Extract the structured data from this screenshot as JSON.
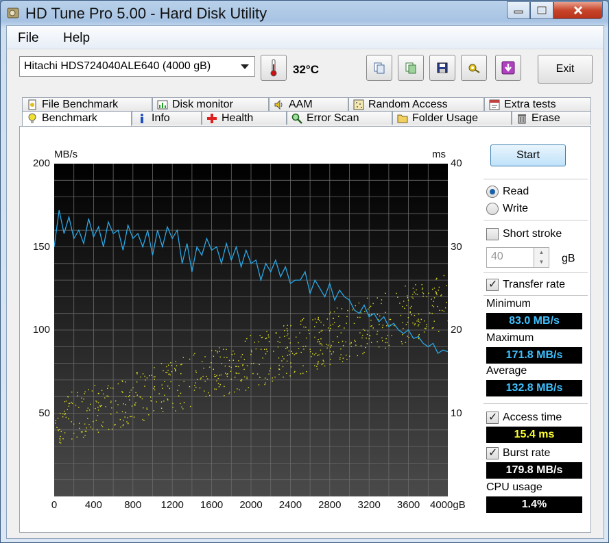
{
  "window": {
    "title": "HD Tune Pro 5.00 - Hard Disk Utility"
  },
  "menu": {
    "file": "File",
    "help": "Help"
  },
  "toolbar": {
    "drive": "Hitachi HDS724040ALE640  (4000 gB)",
    "temperature": "32°C",
    "exit_label": "Exit",
    "icons": [
      "copy-info-icon",
      "copy-screenshot-icon",
      "save-icon",
      "options-icon",
      "download-icon"
    ]
  },
  "tabs_top": [
    "File Benchmark",
    "Disk monitor",
    "AAM",
    "Random Access",
    "Extra tests"
  ],
  "tabs_bottom": [
    "Benchmark",
    "Info",
    "Health",
    "Error Scan",
    "Folder Usage",
    "Erase"
  ],
  "controls": {
    "start_label": "Start",
    "read_label": "Read",
    "write_label": "Write",
    "mode": "read",
    "short_stroke_label": "Short stroke",
    "short_stroke_checked": false,
    "short_stroke_value": "40",
    "short_stroke_unit": "gB",
    "transfer_rate_label": "Transfer rate",
    "transfer_rate_checked": true,
    "access_time_label": "Access time",
    "access_time_checked": true,
    "burst_rate_label": "Burst rate",
    "burst_rate_checked": true,
    "cpu_label": "CPU usage"
  },
  "stats": {
    "minimum_label": "Minimum",
    "minimum": "83.0 MB/s",
    "maximum_label": "Maximum",
    "maximum": "171.8 MB/s",
    "average_label": "Average",
    "average": "132.8 MB/s",
    "access_time": "15.4 ms",
    "burst_rate": "179.8 MB/s",
    "cpu_usage": "1.4%"
  },
  "chart_data": {
    "type": "line",
    "y_left_label": "MB/s",
    "y_right_label": "ms",
    "y_left_ticks": [
      "50",
      "100",
      "150",
      "200"
    ],
    "y_right_ticks": [
      "10",
      "20",
      "30",
      "40"
    ],
    "x_ticks": [
      "0",
      "400",
      "800",
      "1200",
      "1600",
      "2000",
      "2400",
      "2800",
      "3200",
      "3600",
      "4000gB"
    ],
    "xlim": [
      0,
      4000
    ],
    "ylim_left": [
      0,
      200
    ],
    "ylim_right": [
      0,
      40
    ],
    "grid": true,
    "colors": {
      "transfer": "#2aa8e6",
      "access": "#e6e620",
      "bg_top": "#000000",
      "bg_bottom": "#4a4a4a",
      "grid": "#6a6a6a"
    },
    "transfer_series": {
      "name": "Transfer rate",
      "x": [
        0,
        50,
        100,
        150,
        200,
        250,
        300,
        350,
        400,
        450,
        500,
        550,
        600,
        650,
        700,
        750,
        800,
        850,
        900,
        950,
        1000,
        1050,
        1100,
        1150,
        1200,
        1250,
        1300,
        1350,
        1400,
        1450,
        1500,
        1550,
        1600,
        1650,
        1700,
        1750,
        1800,
        1850,
        1900,
        1950,
        2000,
        2050,
        2100,
        2150,
        2200,
        2250,
        2300,
        2350,
        2400,
        2450,
        2500,
        2550,
        2600,
        2650,
        2700,
        2750,
        2800,
        2850,
        2900,
        2950,
        3000,
        3050,
        3100,
        3150,
        3200,
        3250,
        3300,
        3350,
        3400,
        3450,
        3500,
        3550,
        3600,
        3650,
        3700,
        3750,
        3800,
        3850,
        3900,
        3950,
        4000
      ],
      "values": [
        150,
        172,
        158,
        168,
        155,
        160,
        152,
        167,
        156,
        162,
        150,
        165,
        158,
        160,
        148,
        163,
        155,
        158,
        150,
        160,
        145,
        160,
        150,
        162,
        155,
        160,
        140,
        152,
        135,
        150,
        145,
        155,
        148,
        150,
        140,
        152,
        142,
        150,
        138,
        148,
        140,
        142,
        130,
        140,
        135,
        142,
        132,
        138,
        128,
        130,
        130,
        135,
        122,
        130,
        125,
        120,
        128,
        118,
        124,
        120,
        118,
        112,
        110,
        115,
        108,
        110,
        105,
        108,
        102,
        104,
        100,
        98,
        100,
        95,
        96,
        92,
        90,
        92,
        86,
        88,
        87
      ]
    },
    "access_series": {
      "name": "Access time",
      "ms_range_start": [
        6,
        12
      ],
      "ms_range_end": [
        20,
        27
      ],
      "points": 700
    }
  }
}
